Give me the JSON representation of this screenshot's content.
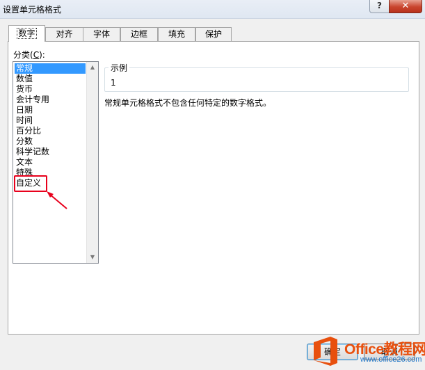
{
  "window": {
    "title": "设置单元格格式",
    "help": "?",
    "close": "✕"
  },
  "tabs": [
    {
      "label": "数字",
      "active": true
    },
    {
      "label": "对齐"
    },
    {
      "label": "字体"
    },
    {
      "label": "边框"
    },
    {
      "label": "填充"
    },
    {
      "label": "保护"
    }
  ],
  "category": {
    "label_prefix": "分类(",
    "label_hotkey": "C",
    "label_suffix": "):",
    "items": [
      "常规",
      "数值",
      "货币",
      "会计专用",
      "日期",
      "时间",
      "百分比",
      "分数",
      "科学记数",
      "文本",
      "特殊",
      "自定义"
    ],
    "selected_index": 0,
    "highlighted_index": 11
  },
  "sample": {
    "legend": "示例",
    "value": "1"
  },
  "description": "常规单元格格式不包含任何特定的数字格式。",
  "buttons": {
    "ok": "确定",
    "cancel": "取消"
  },
  "watermark": {
    "brand": "Office教程网",
    "url": "www.office26.com"
  },
  "colors": {
    "highlight": "#e8001c",
    "selection": "#3399ff",
    "brand_orange": "#e8500e",
    "brand_blue": "#1b74c8"
  }
}
